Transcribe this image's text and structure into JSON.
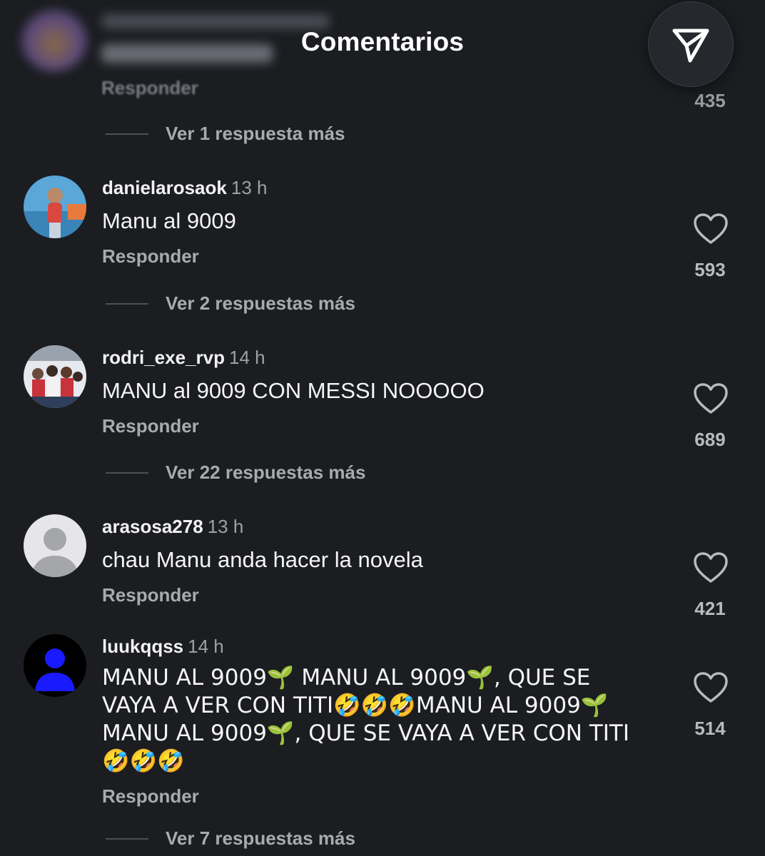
{
  "header": {
    "title": "Comentarios",
    "share_icon": "paper-plane-icon"
  },
  "top_comment": {
    "reply_label": "Responder",
    "likes": "435",
    "view_replies": "Ver 1 respuesta más"
  },
  "comments": [
    {
      "username": "danielarosaok",
      "time": "13 h",
      "text": "Manu al 9009",
      "reply_label": "Responder",
      "likes": "593",
      "view_replies": "Ver 2 respuestas más"
    },
    {
      "username": "rodri_exe_rvp",
      "time": "14 h",
      "text": "MANU al 9009 CON MESSI NOOOOO",
      "reply_label": "Responder",
      "likes": "689",
      "view_replies": "Ver 22 respuestas más"
    },
    {
      "username": "arasosa278",
      "time": "13 h",
      "text": "chau Manu anda hacer la novela",
      "reply_label": "Responder",
      "likes": "421"
    },
    {
      "username": "luukqqss",
      "time": "14 h",
      "lines": [
        "MANU AL 9009🌱 MANU AL 9009🌱, QUE SE",
        "VAYA A VER CON TITI🤣🤣🤣MANU AL 9009🌱",
        "MANU AL 9009🌱, QUE SE VAYA A VER CON TITI",
        "🤣🤣🤣"
      ],
      "reply_label": "Responder",
      "likes": "514",
      "view_replies": "Ver 7 respuestas más"
    }
  ],
  "colors": {
    "background": "#1b1d21",
    "muted_text": "#a8aaae",
    "primary_text": "#f5f5f5"
  }
}
